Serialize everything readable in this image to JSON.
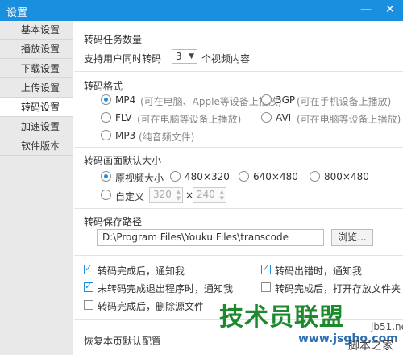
{
  "window": {
    "title": "设置",
    "minimize_label": "—",
    "close_label": "✕"
  },
  "sidebar": {
    "items": [
      {
        "label": "基本设置"
      },
      {
        "label": "播放设置"
      },
      {
        "label": "下载设置"
      },
      {
        "label": "上传设置"
      },
      {
        "label": "转码设置",
        "active": true
      },
      {
        "label": "加速设置"
      },
      {
        "label": "软件版本"
      }
    ]
  },
  "task_count": {
    "title": "转码任务数量",
    "prefix": "支持用户同时转码",
    "selected": "3",
    "suffix": "个视频内容"
  },
  "format": {
    "title": "转码格式",
    "options": [
      {
        "name": "MP4",
        "note": "(可在电脑、Apple等设备上播放)",
        "checked": true
      },
      {
        "name": "3GP",
        "note": "(可在手机设备上播放)",
        "checked": false
      },
      {
        "name": "FLV",
        "note": "(可在电脑等设备上播放)",
        "checked": false
      },
      {
        "name": "AVI",
        "note": "(可在电脑等设备上播放)",
        "checked": false
      },
      {
        "name": "MP3",
        "note": "(纯音频文件)",
        "checked": false
      }
    ]
  },
  "size": {
    "title": "转码画面默认大小",
    "options": [
      {
        "label": "原视频大小",
        "checked": true
      },
      {
        "label": "480×320",
        "checked": false
      },
      {
        "label": "640×480",
        "checked": false
      },
      {
        "label": "800×480",
        "checked": false
      }
    ],
    "custom": {
      "label": "自定义",
      "width": "320",
      "separator": "×",
      "height": "240"
    }
  },
  "path": {
    "title": "转码保存路径",
    "value": "D:\\Program Files\\Youku Files\\transcode",
    "browse_label": "浏览..."
  },
  "notify": {
    "items": [
      {
        "label": "转码完成后，通知我",
        "checked": true
      },
      {
        "label": "转码出错时，通知我",
        "checked": true
      },
      {
        "label": "未转码完成退出程序时，通知我",
        "checked": true
      },
      {
        "label": "转码完成后，打开存放文件夹",
        "checked": false
      },
      {
        "label": "转码完成后，删除源文件",
        "checked": false
      }
    ]
  },
  "restore_label": "恢复本页默认配置",
  "watermark": {
    "brand": "技术员联盟",
    "url": "www.jsgho.com",
    "corner": "jb51.net",
    "small": "脚本之家"
  },
  "colors": {
    "accent": "#1a8fe0",
    "titlebar": "#1a8fe0",
    "sidebar_bg": "#e9e9e9",
    "watermark_green": "#1e8a2e"
  }
}
